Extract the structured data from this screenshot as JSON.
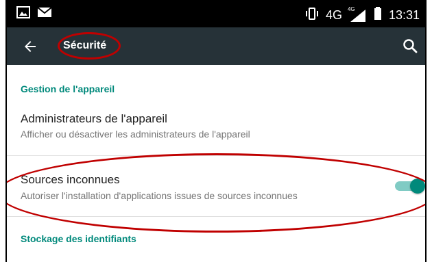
{
  "status_bar": {
    "network": "4G",
    "network_badge": "4G",
    "time": "13:31"
  },
  "toolbar": {
    "title": "Sécurité"
  },
  "sections": [
    {
      "header": "Gestion de l'appareil",
      "items": [
        {
          "title": "Administrateurs de l'appareil",
          "summary": "Afficher ou désactiver les administrateurs de l'appareil"
        },
        {
          "title": "Sources inconnues",
          "summary": "Autoriser l'installation d'applications issues de sources inconnues",
          "toggle_on": true
        }
      ]
    },
    {
      "header": "Stockage des identifiants"
    }
  ],
  "colors": {
    "accent": "#00897b",
    "toolbar": "#263238",
    "annotation": "#c00000"
  }
}
